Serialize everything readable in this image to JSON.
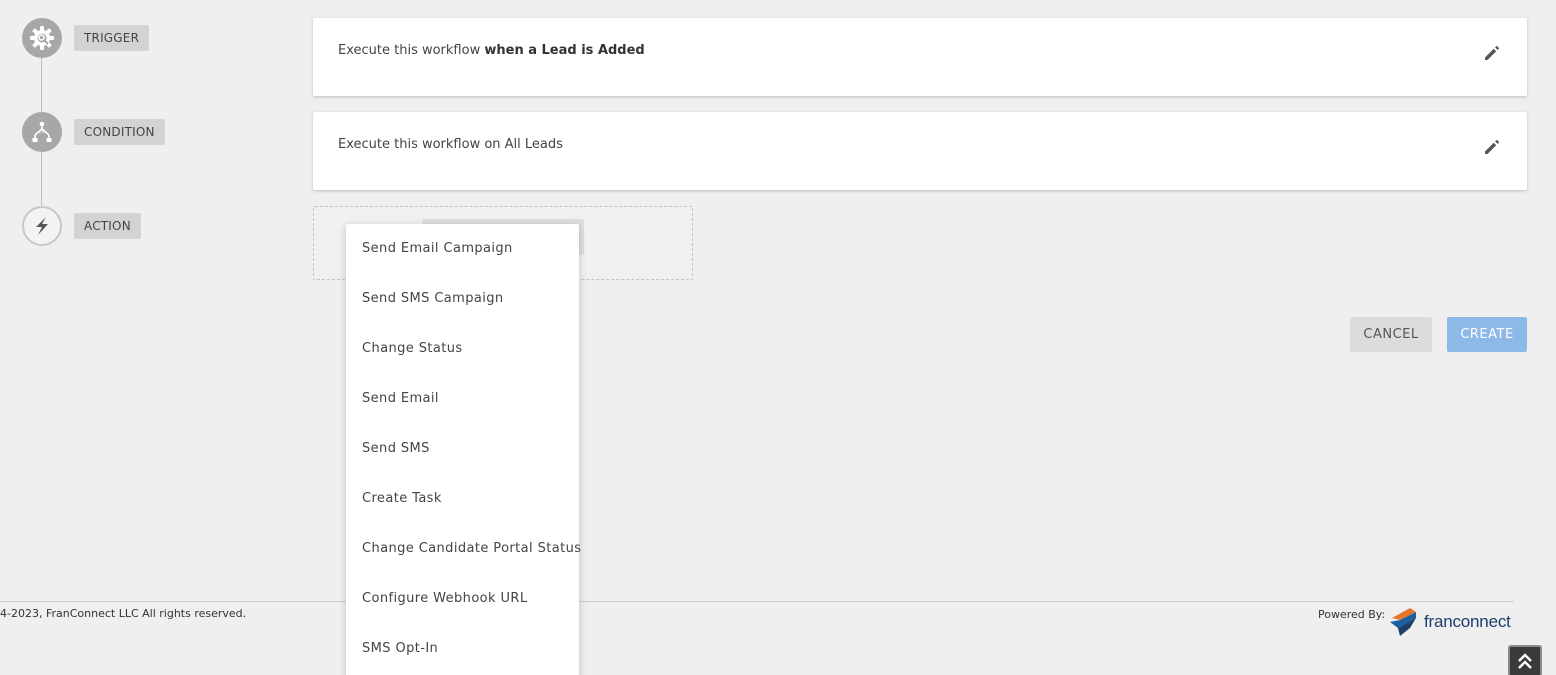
{
  "steps": {
    "trigger_label": "TRIGGER",
    "condition_label": "CONDITION",
    "action_label": "ACTION"
  },
  "trigger_card": {
    "prefix": "Execute this workflow",
    "emphasis": "when a Lead is Added"
  },
  "condition_card": {
    "text": "Execute this workflow on All Leads"
  },
  "action_menu": {
    "items": [
      "Send Email Campaign",
      "Send SMS Campaign",
      "Change Status",
      "Send Email",
      "Send SMS",
      "Create Task",
      "Change Candidate Portal Status",
      "Configure Webhook URL",
      "SMS Opt-In"
    ]
  },
  "buttons": {
    "cancel": "CANCEL",
    "create": "CREATE"
  },
  "footer": {
    "copyright": "4-2023, FranConnect LLC All rights reserved.",
    "powered_by": "Powered By:",
    "logo_text_fran": "fran",
    "logo_text_connect": "connect"
  },
  "colors": {
    "create_button": "#8db9e8",
    "logo_orange": "#e8742a",
    "logo_blue": "#1b5fa0"
  },
  "icons": {
    "trigger": "gear-icon",
    "condition": "branch-icon",
    "action": "lightning-icon",
    "edit": "pencil-icon",
    "scroll_top": "double-chevron-up-icon"
  }
}
